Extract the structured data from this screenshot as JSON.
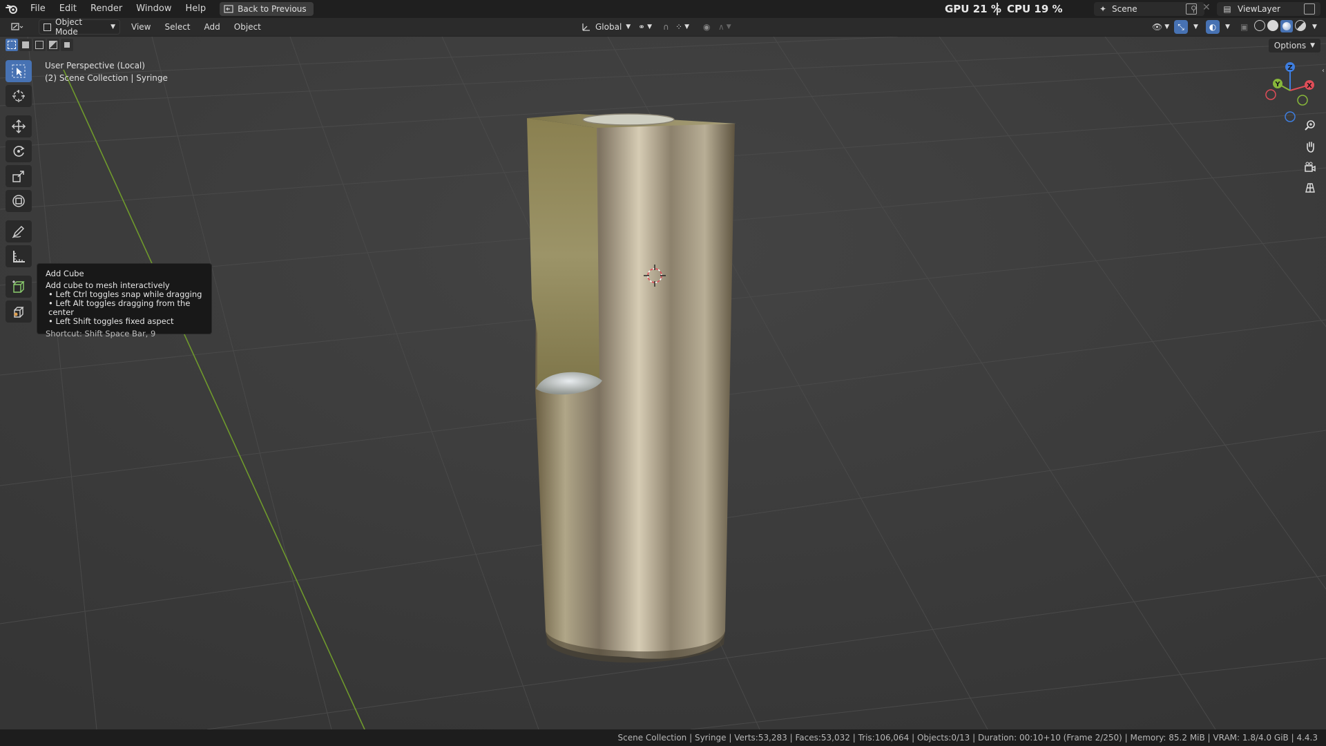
{
  "menubar": {
    "items": [
      "File",
      "Edit",
      "Render",
      "Window",
      "Help"
    ],
    "back_button": "Back to Previous"
  },
  "perf": {
    "gpu_label": "GPU",
    "gpu_value": "21 %",
    "cpu_label": "CPU",
    "cpu_value": "19 %"
  },
  "scene": {
    "name": "Scene",
    "view_layer": "ViewLayer"
  },
  "header": {
    "mode": "Object Mode",
    "menus": [
      "View",
      "Select",
      "Add",
      "Object"
    ],
    "transform_orientation": "Global",
    "options_label": "Options"
  },
  "viewport": {
    "perspective": "User Perspective (Local)",
    "collection_info": "(2) Scene Collection | Syringe"
  },
  "tooltip": {
    "title": "Add Cube",
    "description": "Add cube to mesh interactively",
    "bullets": [
      "• Left Ctrl toggles snap while dragging",
      "• Left Alt toggles dragging from the center",
      "• Left Shift toggles fixed aspect"
    ],
    "shortcut": "Shortcut: Shift Space Bar, 9"
  },
  "gizmo": {
    "x": "X",
    "y": "Y",
    "z": "Z"
  },
  "status": {
    "text": "Scene Collection | Syringe | Verts:53,283 | Faces:53,032 | Tris:106,064 | Objects:0/13 | Duration: 00:10+10 (Frame 2/250) | Memory: 85.2 MiB | VRAM: 1.8/4.0 GiB | 4.4.3"
  },
  "colors": {
    "accent": "#4772b3",
    "axis_x": "#e04d58",
    "axis_y": "#88b83a",
    "axis_z": "#3e7ee0"
  }
}
